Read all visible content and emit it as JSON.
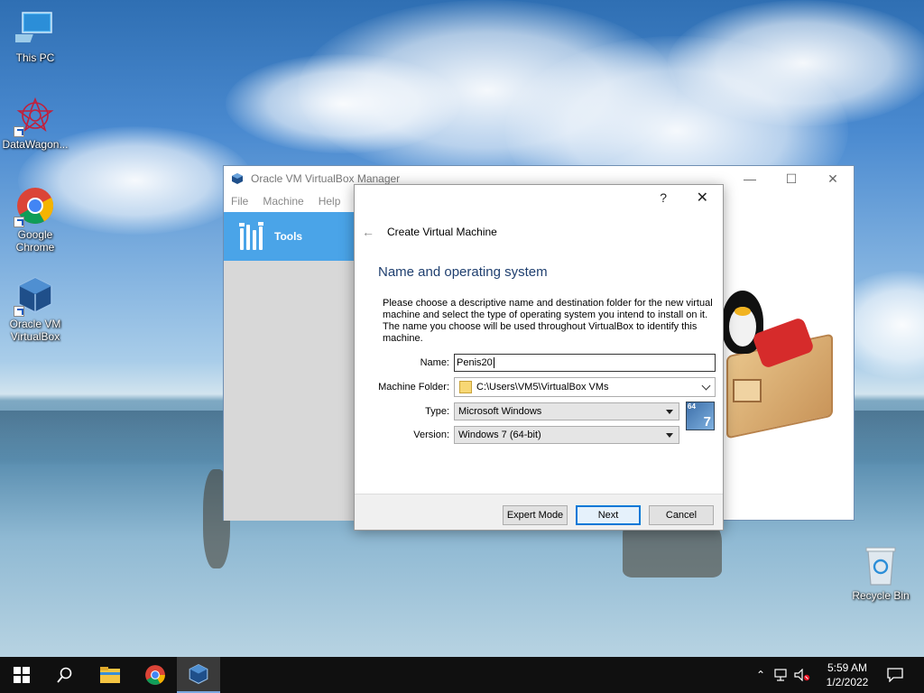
{
  "desktop": {
    "icons": [
      {
        "label": "This PC"
      },
      {
        "label": "DataWagon..."
      },
      {
        "label_line1": "Google",
        "label_line2": "Chrome"
      },
      {
        "label_line1": "Oracle VM",
        "label_line2": "VirtualBox"
      }
    ],
    "recycle_bin": "Recycle Bin"
  },
  "vbox_manager": {
    "title": "Oracle VM VirtualBox Manager",
    "menu": [
      "File",
      "Machine",
      "Help"
    ],
    "tools_label": "Tools"
  },
  "dialog": {
    "help": "?",
    "close": "✕",
    "back": "←",
    "title": "Create Virtual Machine",
    "section_title": "Name and operating system",
    "description": "Please choose a descriptive name and destination folder for the new virtual machine and select the type of operating system you intend to install on it. The name you choose will be used throughout VirtualBox to identify this machine.",
    "name_label": "Name:",
    "name_value": "Penis20",
    "folder_label": "Machine Folder:",
    "folder_value": "C:\\Users\\VM5\\VirtualBox VMs",
    "type_label": "Type:",
    "type_value": "Microsoft Windows",
    "version_label": "Version:",
    "version_value": "Windows 7 (64-bit)",
    "os_badge_bits": "64",
    "os_badge_ver": "7",
    "buttons": {
      "expert": "Expert Mode",
      "next": "Next",
      "cancel": "Cancel"
    }
  },
  "taskbar": {
    "time": "5:59 AM",
    "date": "1/2/2022"
  },
  "colors": {
    "accent": "#4aa4e8",
    "section_title": "#1f3f6f",
    "taskbar": "#101010"
  }
}
